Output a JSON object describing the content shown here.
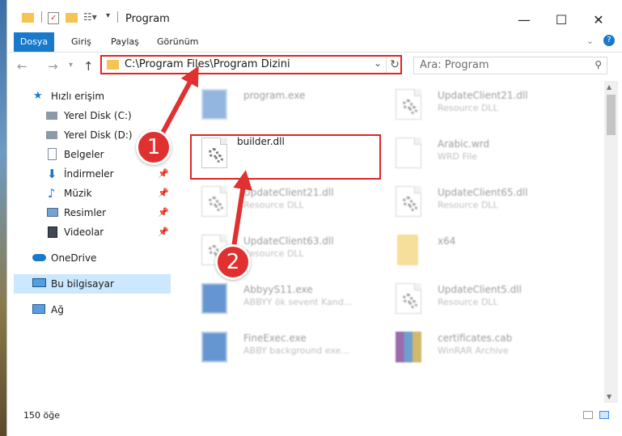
{
  "window": {
    "title": "Program",
    "controls": {
      "minimize": "—",
      "maximize": "☐",
      "close": "✕"
    }
  },
  "ribbon": {
    "tabs": [
      {
        "label": "Dosya"
      },
      {
        "label": "Giriş"
      },
      {
        "label": "Paylaş"
      },
      {
        "label": "Görünüm"
      }
    ],
    "expand_icon": "chevron-down-icon",
    "help_icon": "?"
  },
  "address": {
    "path": "C:\\Program Files\\Program Dizini",
    "search_placeholder": "Ara: Program"
  },
  "sidebar": {
    "items": [
      {
        "label": "Hızlı erişim",
        "icon": "star-icon",
        "pinned": false
      },
      {
        "label": "Yerel Disk (C:)",
        "icon": "drive-icon",
        "pinned": false
      },
      {
        "label": "Yerel Disk (D:)",
        "icon": "drive-icon",
        "pinned": false
      },
      {
        "label": "Belgeler",
        "icon": "documents-icon",
        "pinned": false
      },
      {
        "label": "İndirmeler",
        "icon": "download-icon",
        "pinned": true
      },
      {
        "label": "Müzik",
        "icon": "music-icon",
        "pinned": true
      },
      {
        "label": "Resimler",
        "icon": "pictures-icon",
        "pinned": true
      },
      {
        "label": "Videolar",
        "icon": "videos-icon",
        "pinned": true
      },
      {
        "label": "OneDrive",
        "icon": "onedrive-icon",
        "pinned": false
      },
      {
        "label": "Bu bilgisayar",
        "icon": "computer-icon",
        "pinned": false
      },
      {
        "label": "Ağ",
        "icon": "network-icon",
        "pinned": false
      }
    ]
  },
  "files": [
    {
      "name": "program.exe",
      "sub": "",
      "icon": "exe-icon"
    },
    {
      "name": "builder.dll",
      "sub": "",
      "icon": "dll-icon"
    },
    {
      "name": "UpdateClient21.dll",
      "sub": "Resource DLL",
      "icon": "dll-icon"
    },
    {
      "name": "UpdateClient63.dll",
      "sub": "Resource DLL",
      "icon": "dll-icon"
    },
    {
      "name": "AbbyyS11.exe",
      "sub": "ABBYY ök sevent Kand...",
      "icon": "exe-icon"
    },
    {
      "name": "FineExec.exe",
      "sub": "ABBY background exe...",
      "icon": "exe-icon"
    },
    {
      "name": "UpdateClient21.dll",
      "sub": "Resource DLL",
      "icon": "dll-icon"
    },
    {
      "name": "Arabic.wrd",
      "sub": "WRD File",
      "icon": "file-icon"
    },
    {
      "name": "UpdateClient65.dll",
      "sub": "Resource DLL",
      "icon": "dll-icon"
    },
    {
      "name": "x64",
      "sub": "",
      "icon": "folder-icon"
    },
    {
      "name": "UpdateClient5.dll",
      "sub": "Resource DLL",
      "icon": "dll-icon"
    },
    {
      "name": "certificates.cab",
      "sub": "WinRAR Archive",
      "icon": "rar-icon"
    }
  ],
  "status": {
    "count": "150 öğe"
  },
  "annotations": {
    "step1": "1",
    "step2": "2"
  },
  "colors": {
    "highlight": "#e02424",
    "accent": "#1979ca",
    "selected": "#cce8ff"
  }
}
